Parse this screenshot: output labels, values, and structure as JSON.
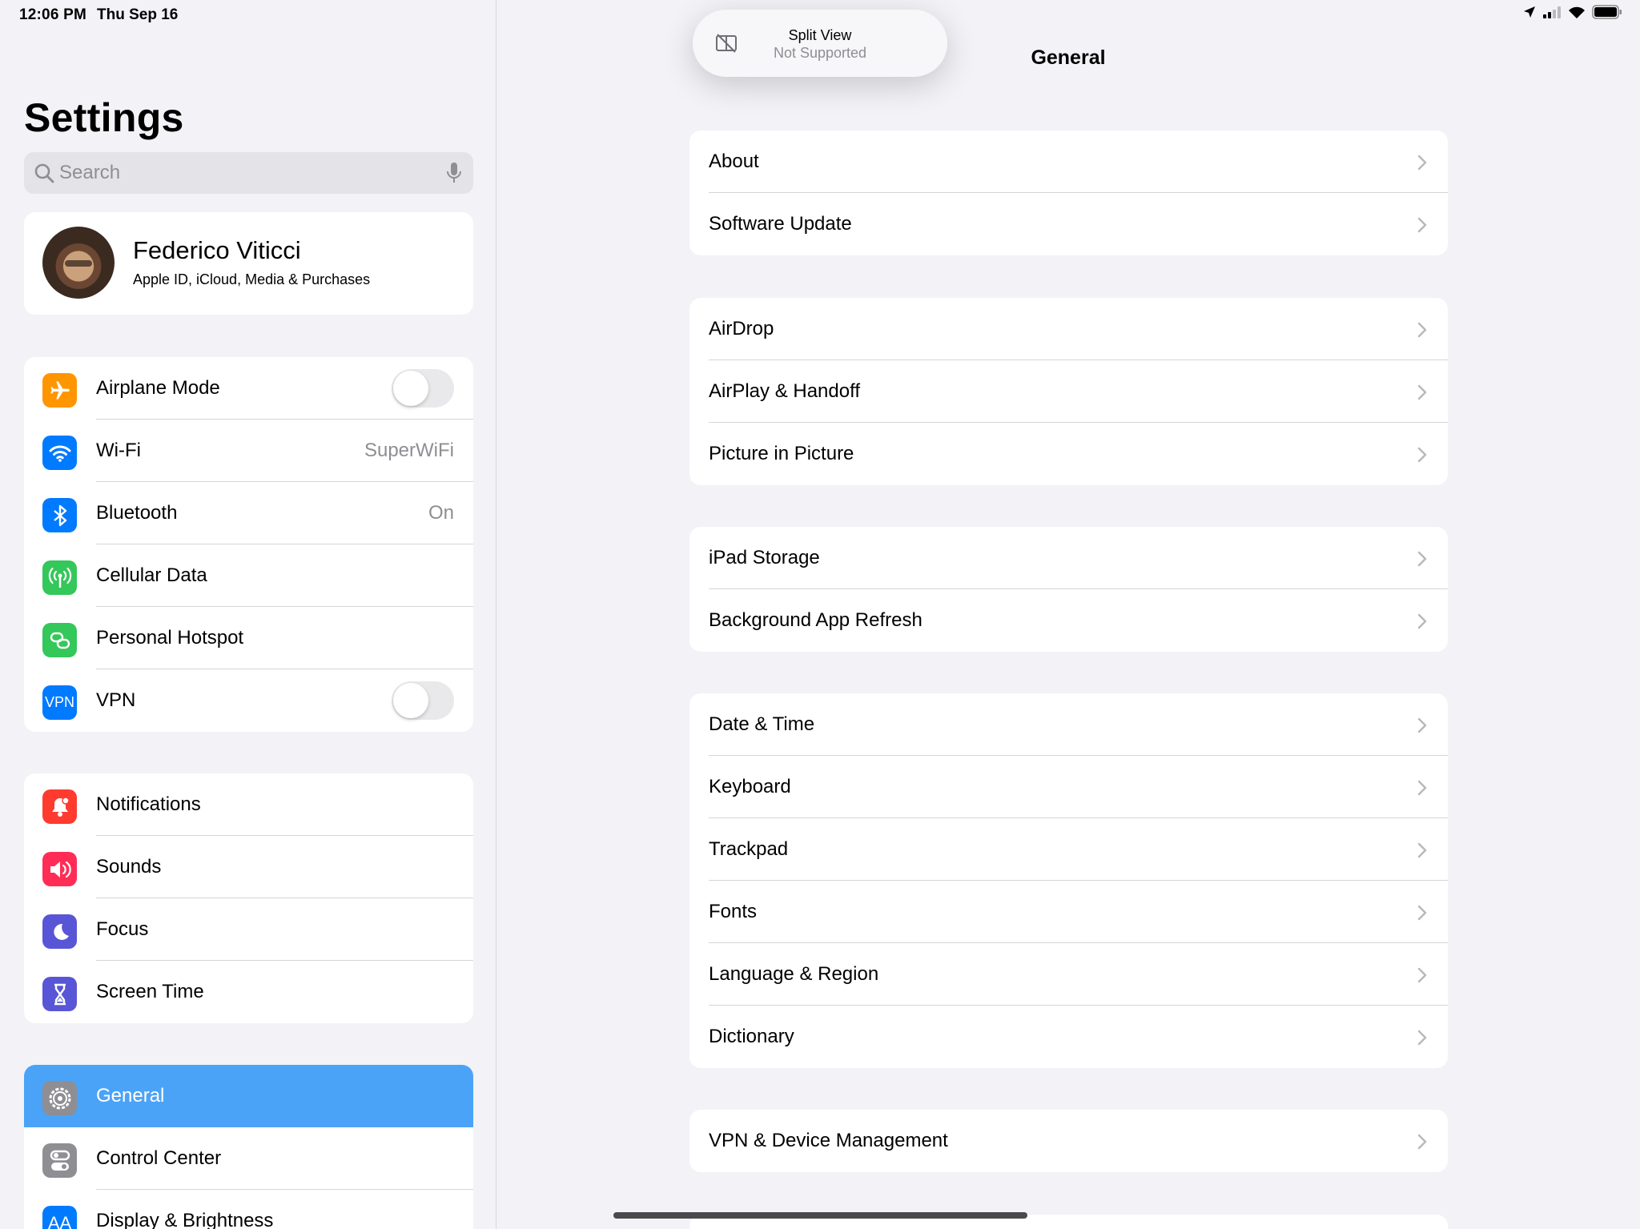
{
  "status_bar": {
    "time": "12:06 PM",
    "date": "Thu Sep 16"
  },
  "sidebar": {
    "title": "Settings",
    "search": {
      "placeholder": "Search"
    },
    "profile": {
      "name": "Federico Viticci",
      "subtitle": "Apple ID, iCloud, Media & Purchases"
    },
    "group1": [
      {
        "label": "Airplane Mode",
        "icon": "airplane-icon",
        "color": "#ff9500",
        "toggle": false
      },
      {
        "label": "Wi-Fi",
        "icon": "wifi-icon",
        "color": "#007aff",
        "value": "SuperWiFi"
      },
      {
        "label": "Bluetooth",
        "icon": "bluetooth-icon",
        "color": "#007aff",
        "value": "On"
      },
      {
        "label": "Cellular Data",
        "icon": "antenna-icon",
        "color": "#34c759"
      },
      {
        "label": "Personal Hotspot",
        "icon": "hotspot-icon",
        "color": "#34c759"
      },
      {
        "label": "VPN",
        "icon": "vpn-icon",
        "icon_text": "VPN",
        "color": "#007aff",
        "toggle": false
      }
    ],
    "group2": [
      {
        "label": "Notifications",
        "icon": "bell-icon",
        "color": "#ff3b30"
      },
      {
        "label": "Sounds",
        "icon": "speaker-icon",
        "color": "#ff2d55"
      },
      {
        "label": "Focus",
        "icon": "moon-icon",
        "color": "#5856d6"
      },
      {
        "label": "Screen Time",
        "icon": "hourglass-icon",
        "color": "#5856d6"
      }
    ],
    "group3": [
      {
        "label": "General",
        "icon": "gear-icon",
        "color": "#8e8e93",
        "selected": true
      },
      {
        "label": "Control Center",
        "icon": "switches-icon",
        "color": "#8e8e93"
      },
      {
        "label": "Display & Brightness",
        "icon": "text-size-icon",
        "icon_text": "AA",
        "color": "#007aff"
      }
    ]
  },
  "detail": {
    "title": "General",
    "groups": [
      [
        "About",
        "Software Update"
      ],
      [
        "AirDrop",
        "AirPlay & Handoff",
        "Picture in Picture"
      ],
      [
        "iPad Storage",
        "Background App Refresh"
      ],
      [
        "Date & Time",
        "Keyboard",
        "Trackpad",
        "Fonts",
        "Language & Region",
        "Dictionary"
      ],
      [
        "VPN & Device Management"
      ]
    ]
  },
  "toast": {
    "title": "Split View",
    "subtitle": "Not Supported",
    "icon": "split-view-unavailable-icon"
  }
}
